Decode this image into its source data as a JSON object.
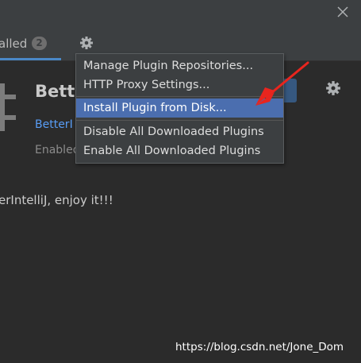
{
  "tabs": {
    "installed": {
      "label": "alled",
      "badge": "2"
    }
  },
  "icons": {
    "close": "close-icon",
    "settings": "gear-icon",
    "plugin": "plugin-icon"
  },
  "plugin": {
    "name": "Bette",
    "vendor_link": "BetterI",
    "status": "Enabled"
  },
  "description": "erIntelliJ, enjoy it!!!",
  "menu": {
    "items": [
      {
        "label": "Manage Plugin Repositories...",
        "selected": false
      },
      {
        "label": "HTTP Proxy Settings...",
        "selected": false
      },
      {
        "label": "Install Plugin from Disk...",
        "selected": true
      },
      {
        "label": "Disable All Downloaded Plugins",
        "selected": false
      },
      {
        "label": "Enable All Downloaded Plugins",
        "selected": false
      }
    ]
  },
  "watermark": "https://blog.csdn.net/Jone_Dom",
  "colors": {
    "accent": "#4a88c7",
    "selection": "#4b6eaf",
    "annotation_arrow": "#e8251e"
  }
}
